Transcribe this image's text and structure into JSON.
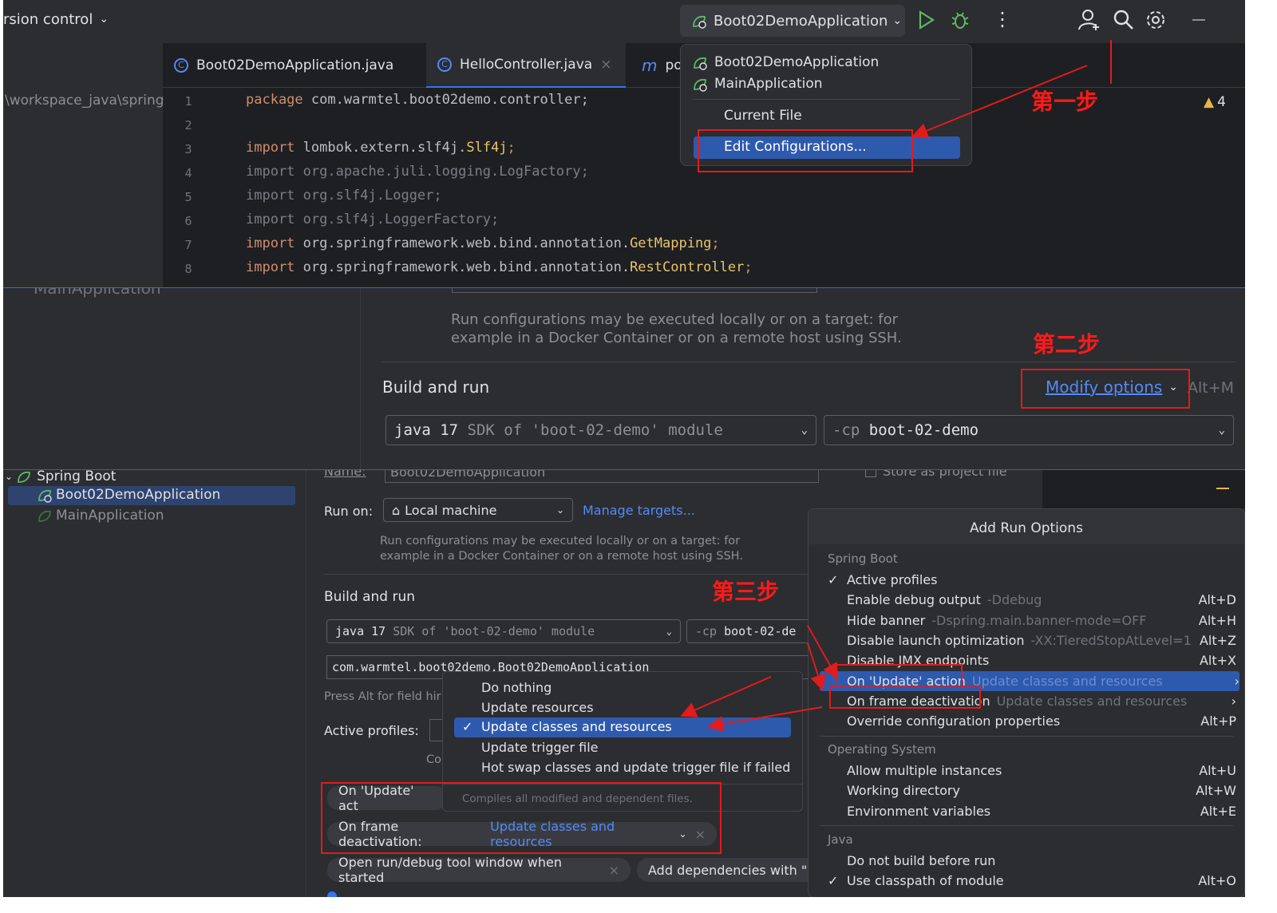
{
  "colors": {
    "bg": "#2b2d30",
    "editor_bg": "#1e1f22",
    "accent": "#3574f0",
    "link": "#548af7",
    "annotation": "#e31b1b",
    "run_green": "#5fb865"
  },
  "titlebar": {
    "vcs": "rsion control",
    "run_config": "Boot02DemoApplication",
    "icons": [
      "run-icon",
      "debug-icon",
      "more-icon",
      "add-user-icon",
      "search-icon",
      "settings-icon",
      "minimize-icon"
    ]
  },
  "tabs": [
    {
      "label": "Boot02DemoApplication.java"
    },
    {
      "label": "HelloController.java",
      "close": "×"
    },
    {
      "label": "po"
    }
  ],
  "project_path": "\\workspace_java\\spring",
  "editor": {
    "lines": [
      "1",
      "2",
      "3",
      "4",
      "5",
      "6",
      "7",
      "8"
    ],
    "line1_kw": "package",
    "line1_rest": " com.warmtel.boot02demo.controller;",
    "line3_kw": "import",
    "line3_rest": " lombok.extern.slf4j.",
    "line3_cls": "Slf4j",
    "line3_end": ";",
    "line4": "import org.apache.juli.logging.LogFactory;",
    "line5": "import org.slf4j.Logger;",
    "line6": "import org.slf4j.LoggerFactory;",
    "line7_kw": "import",
    "line7_rest": " org.springframework.web.bind.annotation.",
    "line7_cls": "GetMapping",
    "line7_end": ";",
    "line8_kw": "import",
    "line8_rest": " org.springframework.web.bind.annotation.",
    "line8_cls": "RestController",
    "line8_end": ";",
    "warnings": "4"
  },
  "run_popup": {
    "items": [
      "Boot02DemoApplication",
      "MainApplication"
    ],
    "current_file": "Current File",
    "edit": "Edit Configurations..."
  },
  "annotations": {
    "step1": "第一步",
    "step2": "第二步",
    "step3": "第三步"
  },
  "panel2": {
    "main_app": "MainApplication",
    "run_configs_note_1": "Run configurations may be executed locally or on a target: for",
    "run_configs_note_2": "example in a Docker Container or on a remote host using SSH.",
    "build_and_run": "Build and run",
    "modify_options": "Modify options",
    "modify_shortcut": "Alt+M",
    "java": "java 17",
    "sdk": "SDK of 'boot-02-demo' module",
    "cp": "-cp",
    "module": "boot-02-demo"
  },
  "tree": {
    "group": "Spring Boot",
    "items": [
      "Boot02DemoApplication",
      "MainApplication"
    ]
  },
  "form": {
    "name_label": "Name:",
    "name_value": "Boot02DemoApplication",
    "store_label": "Store as project file",
    "run_on_label": "Run on:",
    "run_on_value": "Local machine",
    "manage_targets": "Manage targets...",
    "note1": "Run configurations may be executed locally or on a target: for",
    "note2": "example in a Docker Container or on a remote host using SSH.",
    "build_and_run": "Build and run",
    "java": "java 17",
    "sdk": "SDK of 'boot-02-demo' module",
    "cp": "-cp",
    "module": "boot-02-de",
    "main_class": "com.warmtel.boot02demo.Boot02DemoApplication",
    "hint": "Press Alt for field hir",
    "active_profiles": "Active profiles:",
    "co": "Co"
  },
  "update_dropdown": {
    "items": [
      "Do nothing",
      "Update resources",
      "Update classes and resources",
      "Update trigger file",
      "Hot swap classes and update trigger file if failed"
    ],
    "selected": "Update classes and resources",
    "hint": "Compiles all modified and dependent files."
  },
  "chips": {
    "on_update": "On 'Update' act",
    "on_frame_label": "On frame deactivation:",
    "on_frame_value": "Update classes and resources",
    "open_tool": "Open run/debug tool window when started",
    "add_deps": "Add dependencies with \"p"
  },
  "add_run_options": {
    "title": "Add Run Options",
    "spring_boot": "Spring Boot",
    "sb_items": [
      {
        "label": "Active profiles",
        "hint": "",
        "sc": "",
        "check": "✓"
      },
      {
        "label": "Enable debug output",
        "hint": "-Ddebug",
        "sc": "Alt+D",
        "check": ""
      },
      {
        "label": "Hide banner",
        "hint": "-Dspring.main.banner-mode=OFF",
        "sc": "Alt+H",
        "check": ""
      },
      {
        "label": "Disable launch optimization",
        "hint": "-XX:TieredStopAtLevel=1",
        "sc": "Alt+Z",
        "check": ""
      },
      {
        "label": "Disable JMX endpoints",
        "hint": "",
        "sc": "Alt+X",
        "check": ""
      },
      {
        "label": "On 'Update' action",
        "hint": "Update classes and resources",
        "sc": "›",
        "check": ""
      },
      {
        "label": "On frame deactivation",
        "hint": "Update classes and resources",
        "sc": "›",
        "check": ""
      },
      {
        "label": "Override configuration properties",
        "hint": "",
        "sc": "Alt+P",
        "check": ""
      }
    ],
    "os": "Operating System",
    "os_items": [
      {
        "label": "Allow multiple instances",
        "sc": "Alt+U"
      },
      {
        "label": "Working directory",
        "sc": "Alt+W"
      },
      {
        "label": "Environment variables",
        "sc": "Alt+E"
      }
    ],
    "java": "Java",
    "java_items": [
      {
        "label": "Do not build before run",
        "sc": "",
        "check": ""
      },
      {
        "label": "Use classpath of module",
        "sc": "Alt+O",
        "check": "✓"
      }
    ]
  }
}
